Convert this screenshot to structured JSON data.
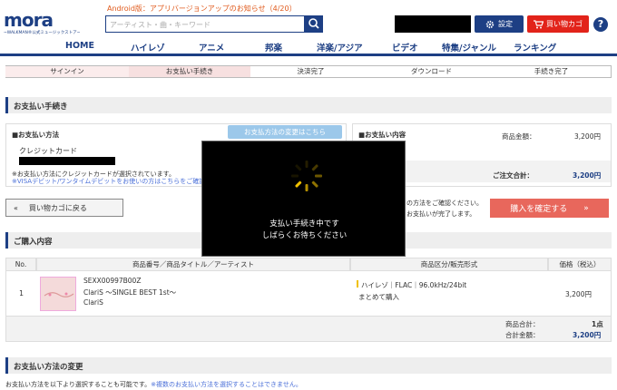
{
  "header": {
    "logo_text": "mora",
    "logo_sub": "~WALKMAN®公式ミュージックストア~",
    "notice": "Android版：アプリバージョンアップのお知らせ（4/20）",
    "search_placeholder": "アーティスト・曲・キーワード",
    "settings_label": "設定",
    "cart_label": "買い物カゴ",
    "help": "?"
  },
  "nav": [
    "HOME",
    "ハイレゾ",
    "アニメ",
    "邦楽",
    "洋楽/アジア",
    "ビデオ",
    "特集/ジャンル",
    "ランキング"
  ],
  "steps": [
    "サインイン",
    "お支払い手続き",
    "決済完了",
    "ダウンロード",
    "手続き完了"
  ],
  "payment": {
    "section_title": "お支払い手続き",
    "method_label": "■お支払い方法",
    "change_button": "お支払方法の変更はこちら",
    "card_name": "クレジットカード",
    "note1": "※お支払い方法にクレジットカードが選択されています。",
    "note2": "※VISAデビット/ワンタイムデビットをお使いの方はこちらをご確認",
    "contents_label": "■お支払い内容",
    "subtotal_label": "商品金額：",
    "subtotal_value": "3,200円",
    "total_label": "ご注文合計：",
    "total_value": "3,200円",
    "confirm_note1": "の方法をご確認ください。",
    "confirm_note2": "お支払いが完了します。",
    "back_button": "買い物カゴに戻る",
    "confirm_button": "購入を確定する"
  },
  "purchase": {
    "section_title": "ご購入内容",
    "headers": [
      "No.",
      "商品番号／商品タイトル／アーティスト",
      "商品区分/販売形式",
      "価格（税込）"
    ],
    "row": {
      "no": "1",
      "code": "SEXX00997B00Z",
      "title": "ClariS ～SINGLE BEST 1st～",
      "artist": "ClariS",
      "format": "ハイレゾ｜FLAC｜96.0kHz/24bit",
      "sale_type": "まとめて購入",
      "price": "3,200円"
    },
    "count_label": "商品合計：",
    "count_value": "1点",
    "sum_label": "合計金額：",
    "sum_value": "3,200円"
  },
  "change": {
    "section_title": "お支払い方法の変更",
    "note_black": "お支払い方法を以下より選択することも可能です。",
    "note_blue": "※複数のお支払い方法を選択することはできません。"
  },
  "modal": {
    "line1": "支払い手続き中です",
    "line2": "しばらくお待ちください"
  },
  "colors": {
    "brand": "#1d3f84",
    "cart_red": "#e2231a",
    "confirm": "#e8675c",
    "accent_blue": "#4a6fd8",
    "spinner": "#f0c000"
  }
}
